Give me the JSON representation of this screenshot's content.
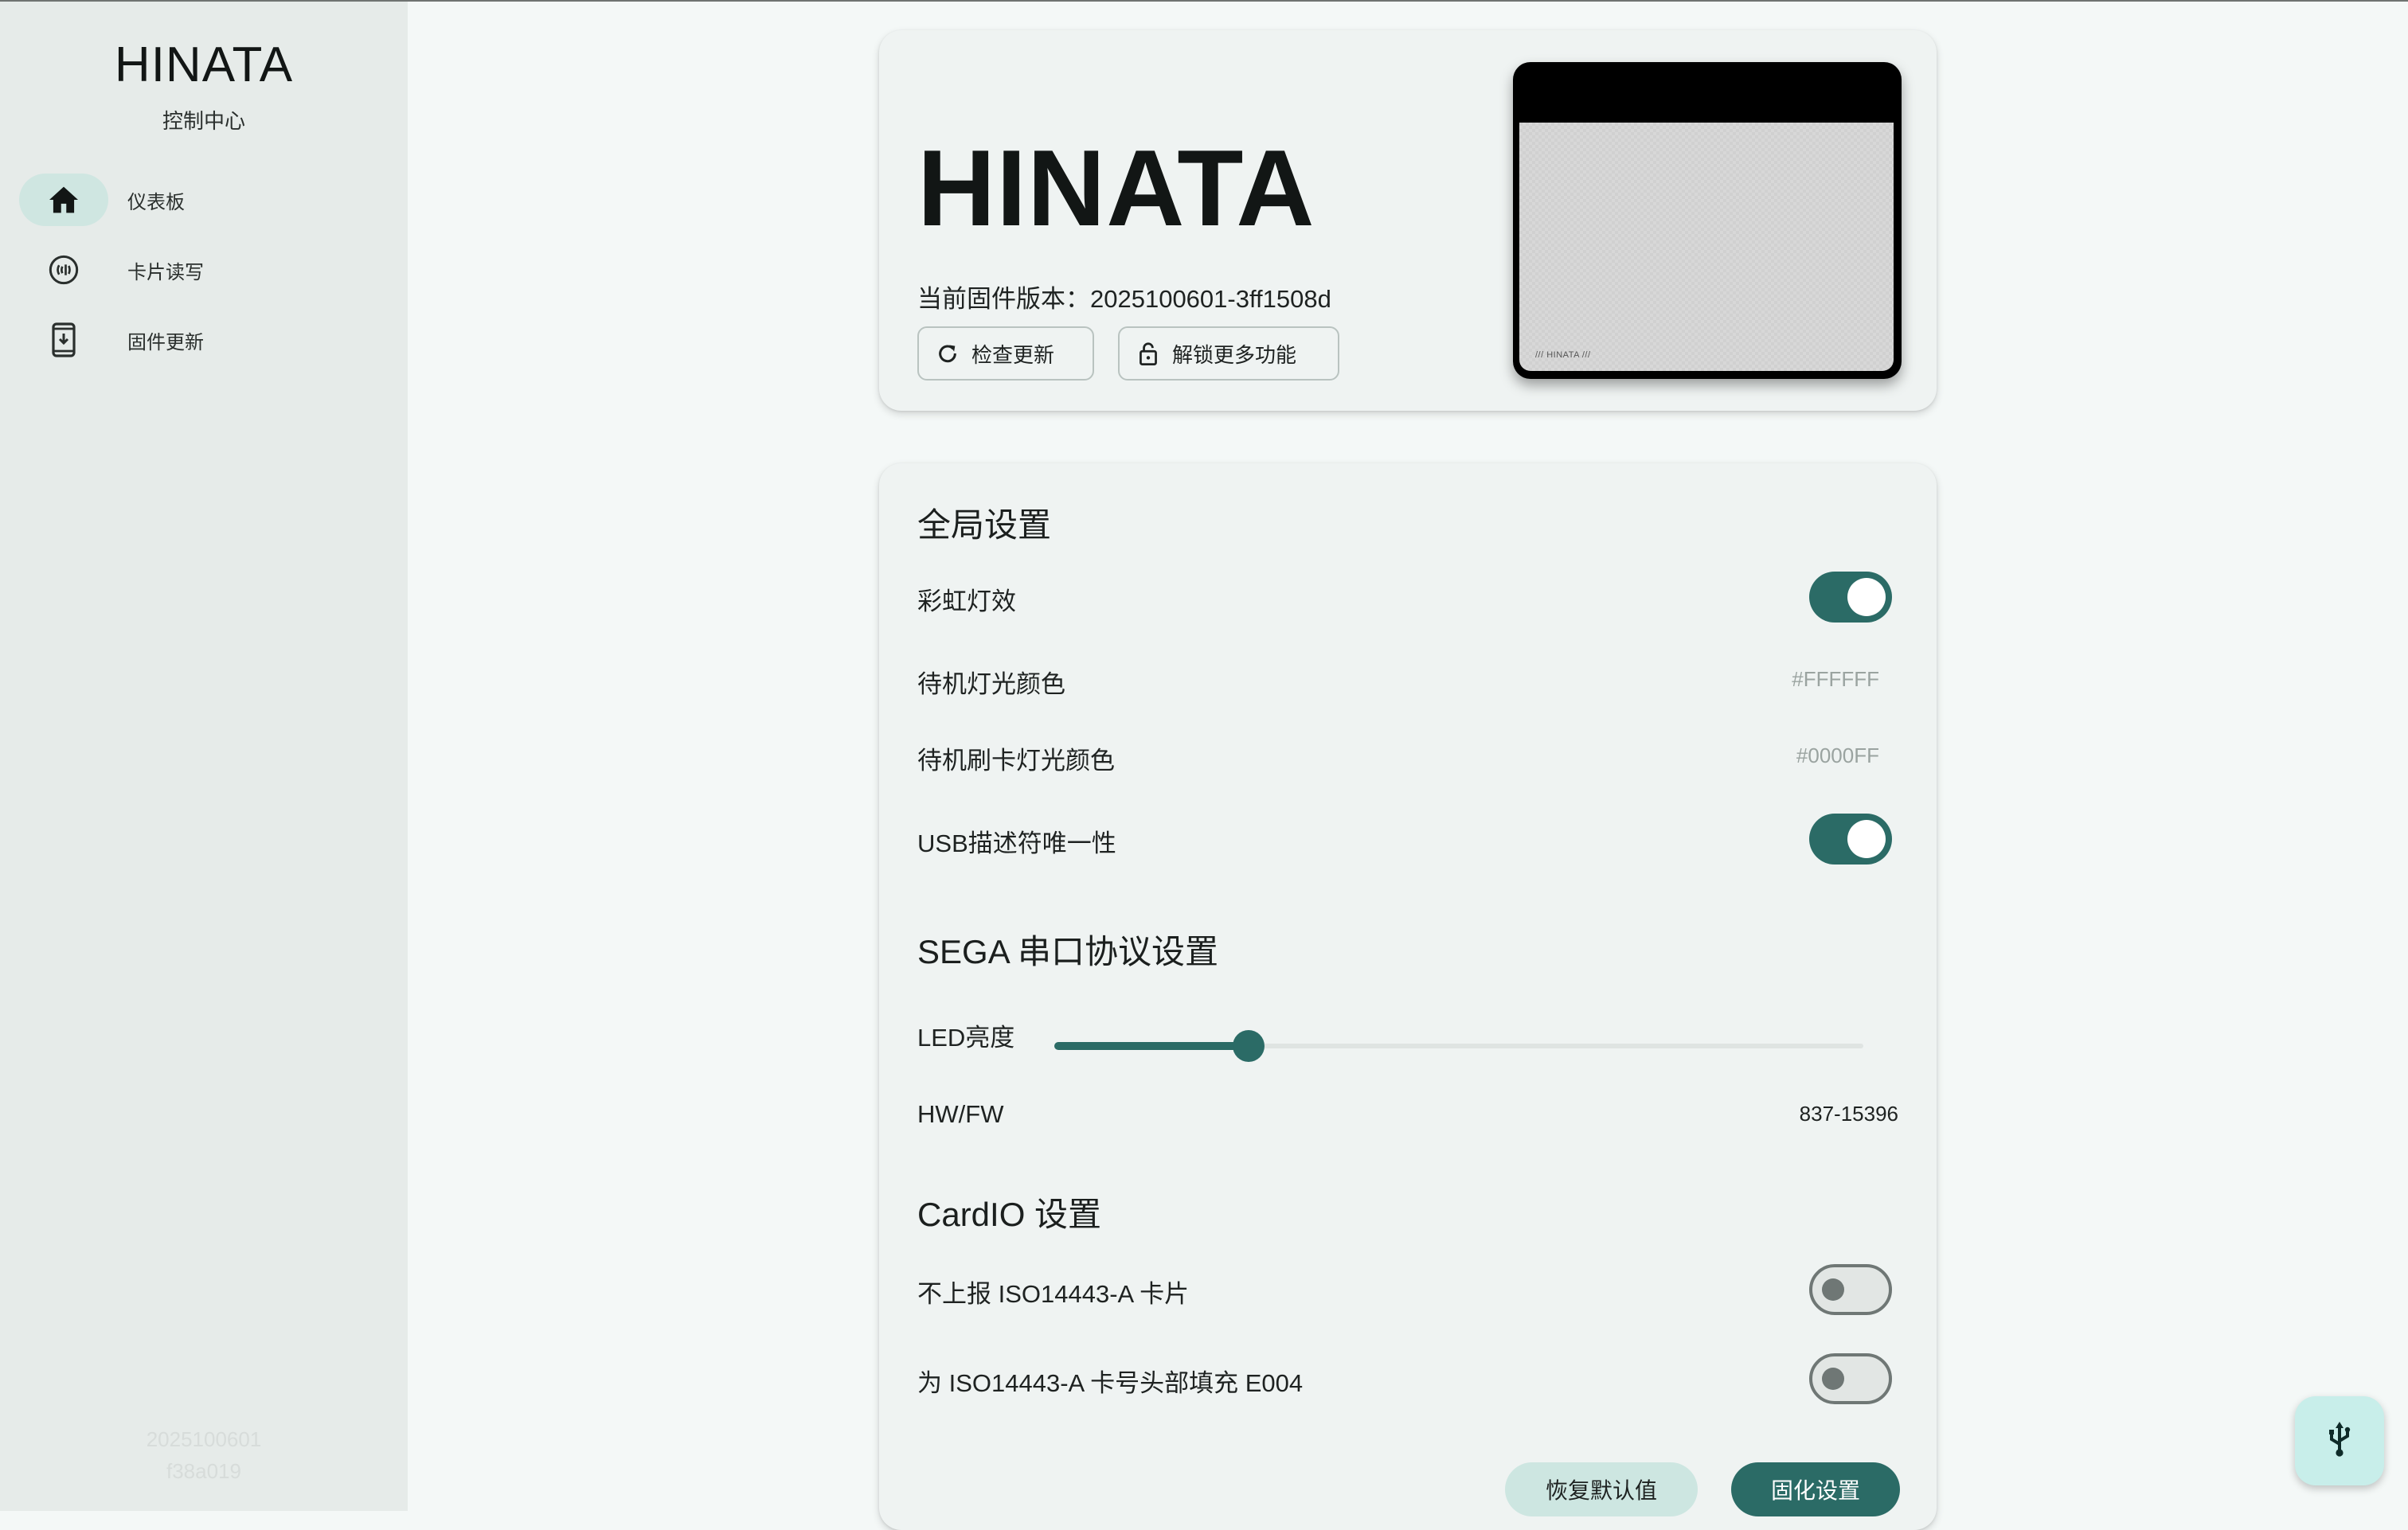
{
  "sidebar": {
    "brand_title": "HINATA",
    "brand_subtitle": "控制中心",
    "items": [
      {
        "label": "仪表板",
        "icon": "home-icon",
        "active": true
      },
      {
        "label": "卡片读写",
        "icon": "nfc-icon",
        "active": false
      },
      {
        "label": "固件更新",
        "icon": "phone-download-icon",
        "active": false
      }
    ],
    "version_line1": "2025100601",
    "version_line2": "f38a019"
  },
  "header_card": {
    "title": "HINATA",
    "firmware_label": "当前固件版本：",
    "firmware_version": "2025100601-3ff1508d",
    "check_update_label": "检查更新",
    "unlock_label": "解锁更多功能",
    "device_screen_label": "/// HINATA ///"
  },
  "settings_card": {
    "global_heading": "全局设置",
    "rainbow_label": "彩虹灯效",
    "rainbow_on": true,
    "idle_color_label": "待机灯光颜色",
    "idle_color_value": "#FFFFFF",
    "idle_swipe_color_label": "待机刷卡灯光颜色",
    "idle_swipe_color_value": "#0000FF",
    "usb_unique_label": "USB描述符唯一性",
    "usb_unique_on": true,
    "sega_heading": "SEGA 串口协议设置",
    "led_brightness_label": "LED亮度",
    "led_brightness_fraction": 0.24,
    "hwfw_label": "HW/FW",
    "hwfw_value": "837-15396",
    "cardio_heading": "CardIO 设置",
    "no_report_label": "不上报 ISO14443-A 卡片",
    "no_report_on": false,
    "pad_label": "为 ISO14443-A 卡号头部填充 E004",
    "pad_on": false,
    "restore_label": "恢复默认值",
    "persist_label": "固化设置"
  },
  "colors": {
    "accent": "#2B6B66",
    "accent_tonal": "#CDE6E1",
    "sidebar_bg": "#E6EBE9",
    "page_bg": "#F4F8F7"
  },
  "fab": {
    "icon": "usb-icon"
  }
}
